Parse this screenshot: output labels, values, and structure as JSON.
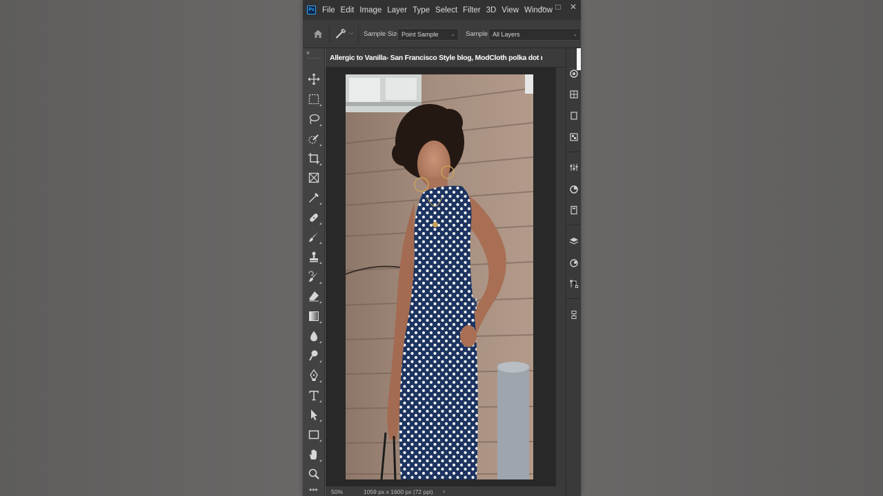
{
  "app": {
    "name": "Photoshop",
    "logo_text": "Ps"
  },
  "menubar": {
    "items": [
      "File",
      "Edit",
      "Image",
      "Layer",
      "Type",
      "Select",
      "Filter",
      "3D",
      "View",
      "Window"
    ],
    "window_controls": {
      "minimize": "–",
      "maximize": "□",
      "close": "✕"
    }
  },
  "options_bar": {
    "sample_size_label": "Sample Size:",
    "sample_size_value": "Point Sample",
    "sample_label": "Sample:",
    "sample_value": "All Layers"
  },
  "toolbar": {
    "collapse_glyph": "››",
    "more_glyph": "•••",
    "tools": [
      "move-tool",
      "rectangular-marquee-tool",
      "lasso-tool",
      "quick-selection-tool",
      "crop-tool",
      "frame-tool",
      "eyedropper-tool",
      "healing-brush-tool",
      "brush-tool",
      "clone-stamp-tool",
      "history-brush-tool",
      "eraser-tool",
      "gradient-tool",
      "blur-tool",
      "dodge-tool",
      "pen-tool",
      "type-tool",
      "path-selection-tool",
      "rectangle-tool",
      "hand-tool",
      "zoom-tool"
    ]
  },
  "document": {
    "tab_title": "Allergic to Vanilla- San Francisco Style blog, ModCloth polka dot navy dress, r",
    "zoom": "50%",
    "info": "1059 px x 1600 px (72 ppi)",
    "arrow": "›"
  },
  "colors": {
    "menubar_bg": "#323232",
    "options_bg": "#3c3c3c",
    "toolbar_bg": "#424242",
    "pasteboard": "#282828",
    "dress_navy": "#1e3563",
    "wall": "#a48c7e",
    "accent": "#31a8ff"
  }
}
